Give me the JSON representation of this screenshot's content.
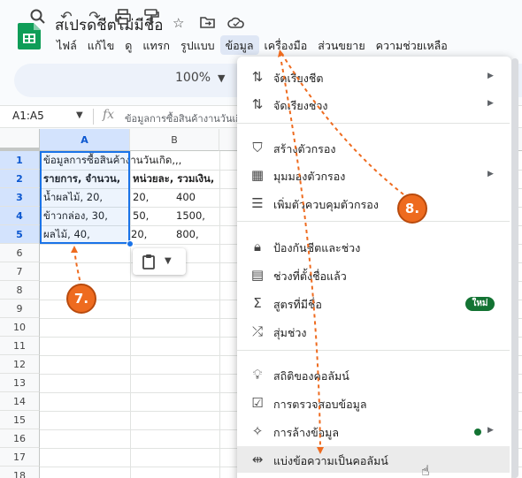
{
  "app": {
    "doc_title": "สเปรดชีตไม่มีชื่อ",
    "colors": {
      "accent": "#1a73e8",
      "annotation": "#ee6b1f",
      "badge": "#137333"
    }
  },
  "title_icons": [
    "star-icon",
    "move-to-folder-icon",
    "cloud-status-icon"
  ],
  "menu": [
    "ไฟล์",
    "แก้ไข",
    "ดู",
    "แทรก",
    "รูปแบบ",
    "ข้อมูล",
    "เครื่องมือ",
    "ส่วนขยาย",
    "ความช่วยเหลือ"
  ],
  "toolbar": {
    "zoom": "100%"
  },
  "formula_bar": {
    "name_box": "A1:A5",
    "fx": "fx",
    "content": "ข้อมูลการซื้อสินค้างานวันเกิด"
  },
  "grid": {
    "columns": [
      "A",
      "B"
    ],
    "rows": [
      "1",
      "2",
      "3",
      "4",
      "5",
      "6",
      "7",
      "8",
      "9",
      "10",
      "11",
      "12",
      "13",
      "14",
      "15",
      "16",
      "17",
      "18"
    ],
    "cells": {
      "a1": "ข้อมูลการซื้อสินค้างานวันเกิด,,,",
      "a2": "รายการ, จำนวน,",
      "b2": "หน่วยละ, รวมเงิน,",
      "a3": "น้ำผลไม้, 20,",
      "b3": "20,",
      "c3": "400",
      "a4": "ข้าวกล่อง, 30,",
      "b4": "50,",
      "c4": "1500,",
      "a5": "ผลไม้, 40,",
      "b5": "20,",
      "c5": "800,"
    }
  },
  "dropdown": {
    "items": [
      {
        "label": "จัดเรียงชีต",
        "icon": "sort-icon",
        "submenu": true
      },
      {
        "label": "จัดเรียงช่วง",
        "icon": "sort-range-icon",
        "submenu": true
      },
      {
        "label": "สร้างตัวกรอง",
        "icon": "filter-icon",
        "submenu": false
      },
      {
        "label": "มุมมองตัวกรอง",
        "icon": "filter-views-icon",
        "submenu": true
      },
      {
        "label": "เพิ่มตัวควบคุมตัวกรอง",
        "icon": "filter-controls-icon",
        "submenu": false
      },
      {
        "label": "ป้องกันชีตและช่วง",
        "icon": "lock-icon",
        "submenu": false
      },
      {
        "label": "ช่วงที่ตั้งชื่อแล้ว",
        "icon": "named-ranges-icon",
        "submenu": false
      },
      {
        "label": "สูตรที่มีชื่อ",
        "icon": "sigma-icon",
        "submenu": false,
        "badge": "ใหม่"
      },
      {
        "label": "สุ่มช่วง",
        "icon": "shuffle-icon",
        "submenu": false
      },
      {
        "label": "สถิติของคอลัมน์",
        "icon": "lightbulb-icon",
        "submenu": false
      },
      {
        "label": "การตรวจสอบข้อมูล",
        "icon": "data-validation-icon",
        "submenu": false
      },
      {
        "label": "การล้างข้อมูล",
        "icon": "magic-wand-icon",
        "submenu": true
      },
      {
        "label": "แบ่งข้อความเป็นคอลัมน์",
        "icon": "split-columns-icon",
        "submenu": false
      }
    ]
  },
  "annotations": {
    "step7": "7.",
    "step8": "8."
  }
}
